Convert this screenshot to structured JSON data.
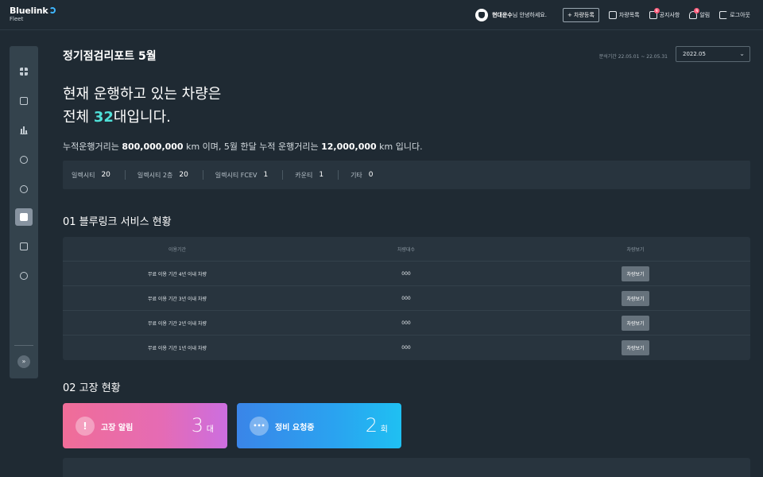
{
  "app": {
    "brand": "Bluelink",
    "brand_sub": "Fleet"
  },
  "header": {
    "user_name": "현대운수",
    "user_greeting": "님 안녕하세요.",
    "register_button": "+ 차량등록",
    "nav": [
      {
        "label": "차량목록",
        "icon": "vehicle-list-icon"
      },
      {
        "label": "공지사항",
        "icon": "notice-icon",
        "badge": "N"
      },
      {
        "label": "알림",
        "icon": "bell-icon",
        "badge": "N"
      },
      {
        "label": "로그아웃",
        "icon": "logout-icon"
      }
    ]
  },
  "sidebar": {
    "items": [
      {
        "icon": "dashboard-icon",
        "active": false
      },
      {
        "icon": "bus-icon",
        "active": false
      },
      {
        "icon": "bar-chart-icon",
        "active": false
      },
      {
        "icon": "compass-icon",
        "active": false
      },
      {
        "icon": "tree-icon",
        "active": false
      },
      {
        "icon": "report-icon",
        "active": true
      },
      {
        "icon": "download-icon",
        "active": false
      },
      {
        "icon": "settings-icon",
        "active": false
      }
    ],
    "expand_icon": "expand-icon",
    "expand_glyph": "»"
  },
  "page": {
    "title": "정기점검리포트 5월",
    "period_label": "분석기간 22.05.01 ~ 22.05.31",
    "period_select": "2022.05",
    "headline_line1": "현재 운행하고 있는 차량은",
    "headline_prefix": "전체 ",
    "headline_count": "32",
    "headline_suffix": "대입니다.",
    "summary_prefix": "누적운행거리는 ",
    "summary_total": "800,000,000",
    "summary_mid": " km 이며, 5월 한달 누적 운행거리는 ",
    "summary_month": "12,000,000",
    "summary_suffix": " km 입니다.",
    "vehicle_types": [
      {
        "label": "일렉시티",
        "count": "20"
      },
      {
        "label": "일렉시티 2층",
        "count": "20"
      },
      {
        "label": "일렉시티 FCEV",
        "count": "1"
      },
      {
        "label": "카운티",
        "count": "1"
      },
      {
        "label": "기타",
        "count": "0"
      }
    ]
  },
  "service": {
    "section_title": "01 블루링크 서비스 현황",
    "columns": [
      "이용기간",
      "차량대수",
      "차량보기"
    ],
    "rows": [
      {
        "period": "무료 이용 기간 4년 이내 차량",
        "count": "000",
        "action": "차량보기"
      },
      {
        "period": "무료 이용 기간 3년 이내 차량",
        "count": "000",
        "action": "차량보기"
      },
      {
        "period": "무료 이용 기간 2년 이내 차량",
        "count": "000",
        "action": "차량보기"
      },
      {
        "period": "무료 이용 기간 1년 이내 차량",
        "count": "000",
        "action": "차량보기"
      }
    ]
  },
  "fault": {
    "section_title": "02 고장 현황",
    "cards": [
      {
        "label": "고장 알림",
        "value": "3",
        "unit": "대",
        "icon": "alert-icon",
        "glyph": "!",
        "color": "#f06d98"
      },
      {
        "label": "정비 요청중",
        "value": "2",
        "unit": "회",
        "icon": "more-icon",
        "glyph": "•••",
        "color": "#2aa3f0"
      }
    ]
  }
}
